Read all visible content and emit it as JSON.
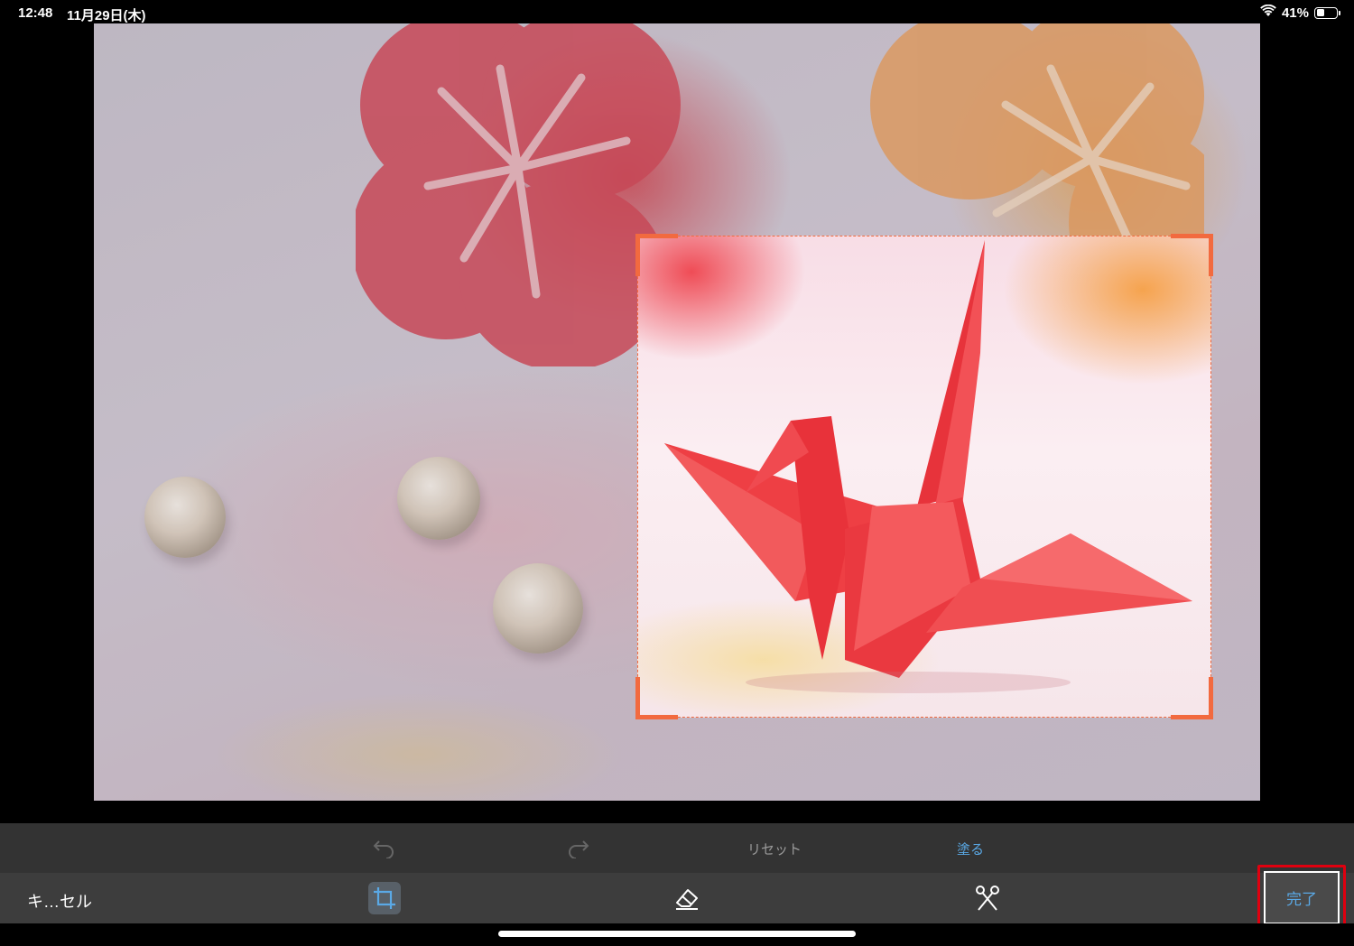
{
  "status_bar": {
    "time": "12:48",
    "date": "11月29日(木)",
    "wifi_icon": "wifi-icon",
    "battery_text": "41%",
    "battery_level": 0.41
  },
  "photo": {
    "subject": "origami crane with paper flowers",
    "selection_color": "#f26a3f"
  },
  "edit_bar": {
    "undo_icon": "undo-icon",
    "redo_icon": "redo-icon",
    "reset_label": "リセット",
    "paint_label": "塗る"
  },
  "main_bar": {
    "cancel_label": "キ…セル",
    "crop_icon": "crop-icon",
    "eraser_icon": "eraser-icon",
    "scissors_icon": "scissors-icon",
    "done_label": "完了"
  },
  "colors": {
    "accent": "#5aa9e6",
    "highlight": "#e0000f",
    "selection": "#f26a3f"
  }
}
